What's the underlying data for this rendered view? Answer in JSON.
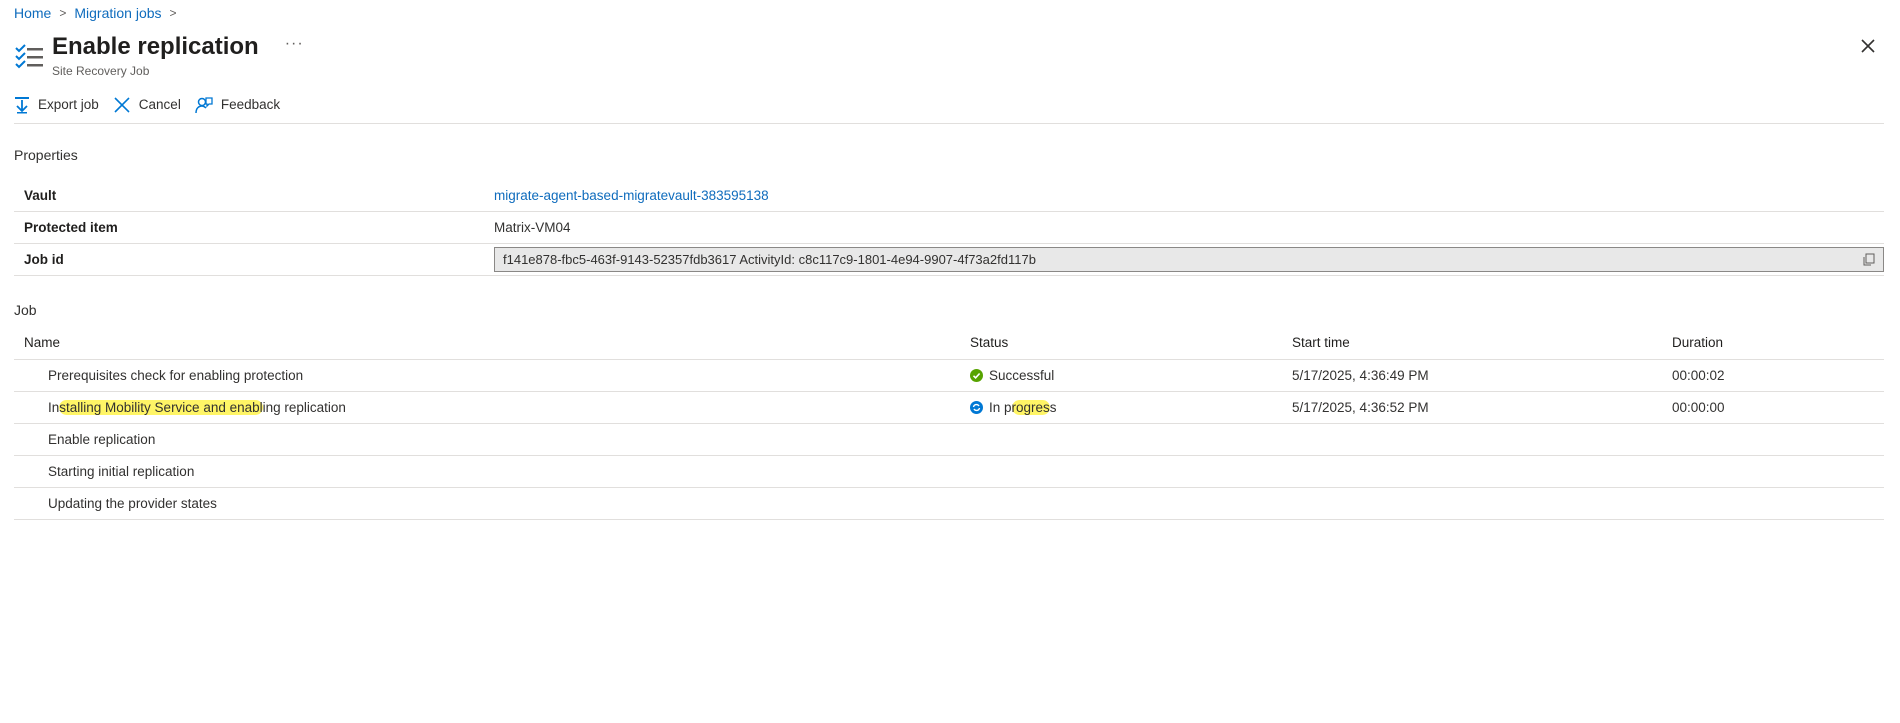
{
  "breadcrumb": {
    "home": "Home",
    "jobs": "Migration jobs",
    "sep": ">"
  },
  "header": {
    "title": "Enable replication",
    "subtitle": "Site Recovery Job",
    "more": "···"
  },
  "toolbar": {
    "export": "Export job",
    "cancel": "Cancel",
    "feedback": "Feedback"
  },
  "properties": {
    "label": "Properties",
    "vault_key": "Vault",
    "vault_value": "migrate-agent-based-migratevault-383595138",
    "protected_key": "Protected item",
    "protected_value": "Matrix-VM04",
    "jobid_key": "Job id",
    "jobid_value": "f141e878-fbc5-463f-9143-52357fdb3617 ActivityId: c8c117c9-1801-4e94-9907-4f73a2fd117b"
  },
  "job": {
    "label": "Job",
    "headers": {
      "name": "Name",
      "status": "Status",
      "start": "Start time",
      "duration": "Duration"
    },
    "rows": [
      {
        "name": "Prerequisites check for enabling protection",
        "status": "Successful",
        "start": "5/17/2025, 4:36:49 PM",
        "duration": "00:00:02"
      },
      {
        "name_a": "In",
        "name_b": "stalling Mobility Service and enabl",
        "name_c": "ing replication",
        "status_a": "In p",
        "status_b": "rogres",
        "status_c": "s",
        "start": "5/17/2025, 4:36:52 PM",
        "duration": "00:00:00"
      },
      {
        "name": "Enable replication"
      },
      {
        "name": "Starting initial replication"
      },
      {
        "name": "Updating the provider states"
      }
    ]
  },
  "colors": {
    "link": "#0f6cbd",
    "success": "#57a300",
    "progress": "#0078d4",
    "highlight": "#fff566"
  }
}
